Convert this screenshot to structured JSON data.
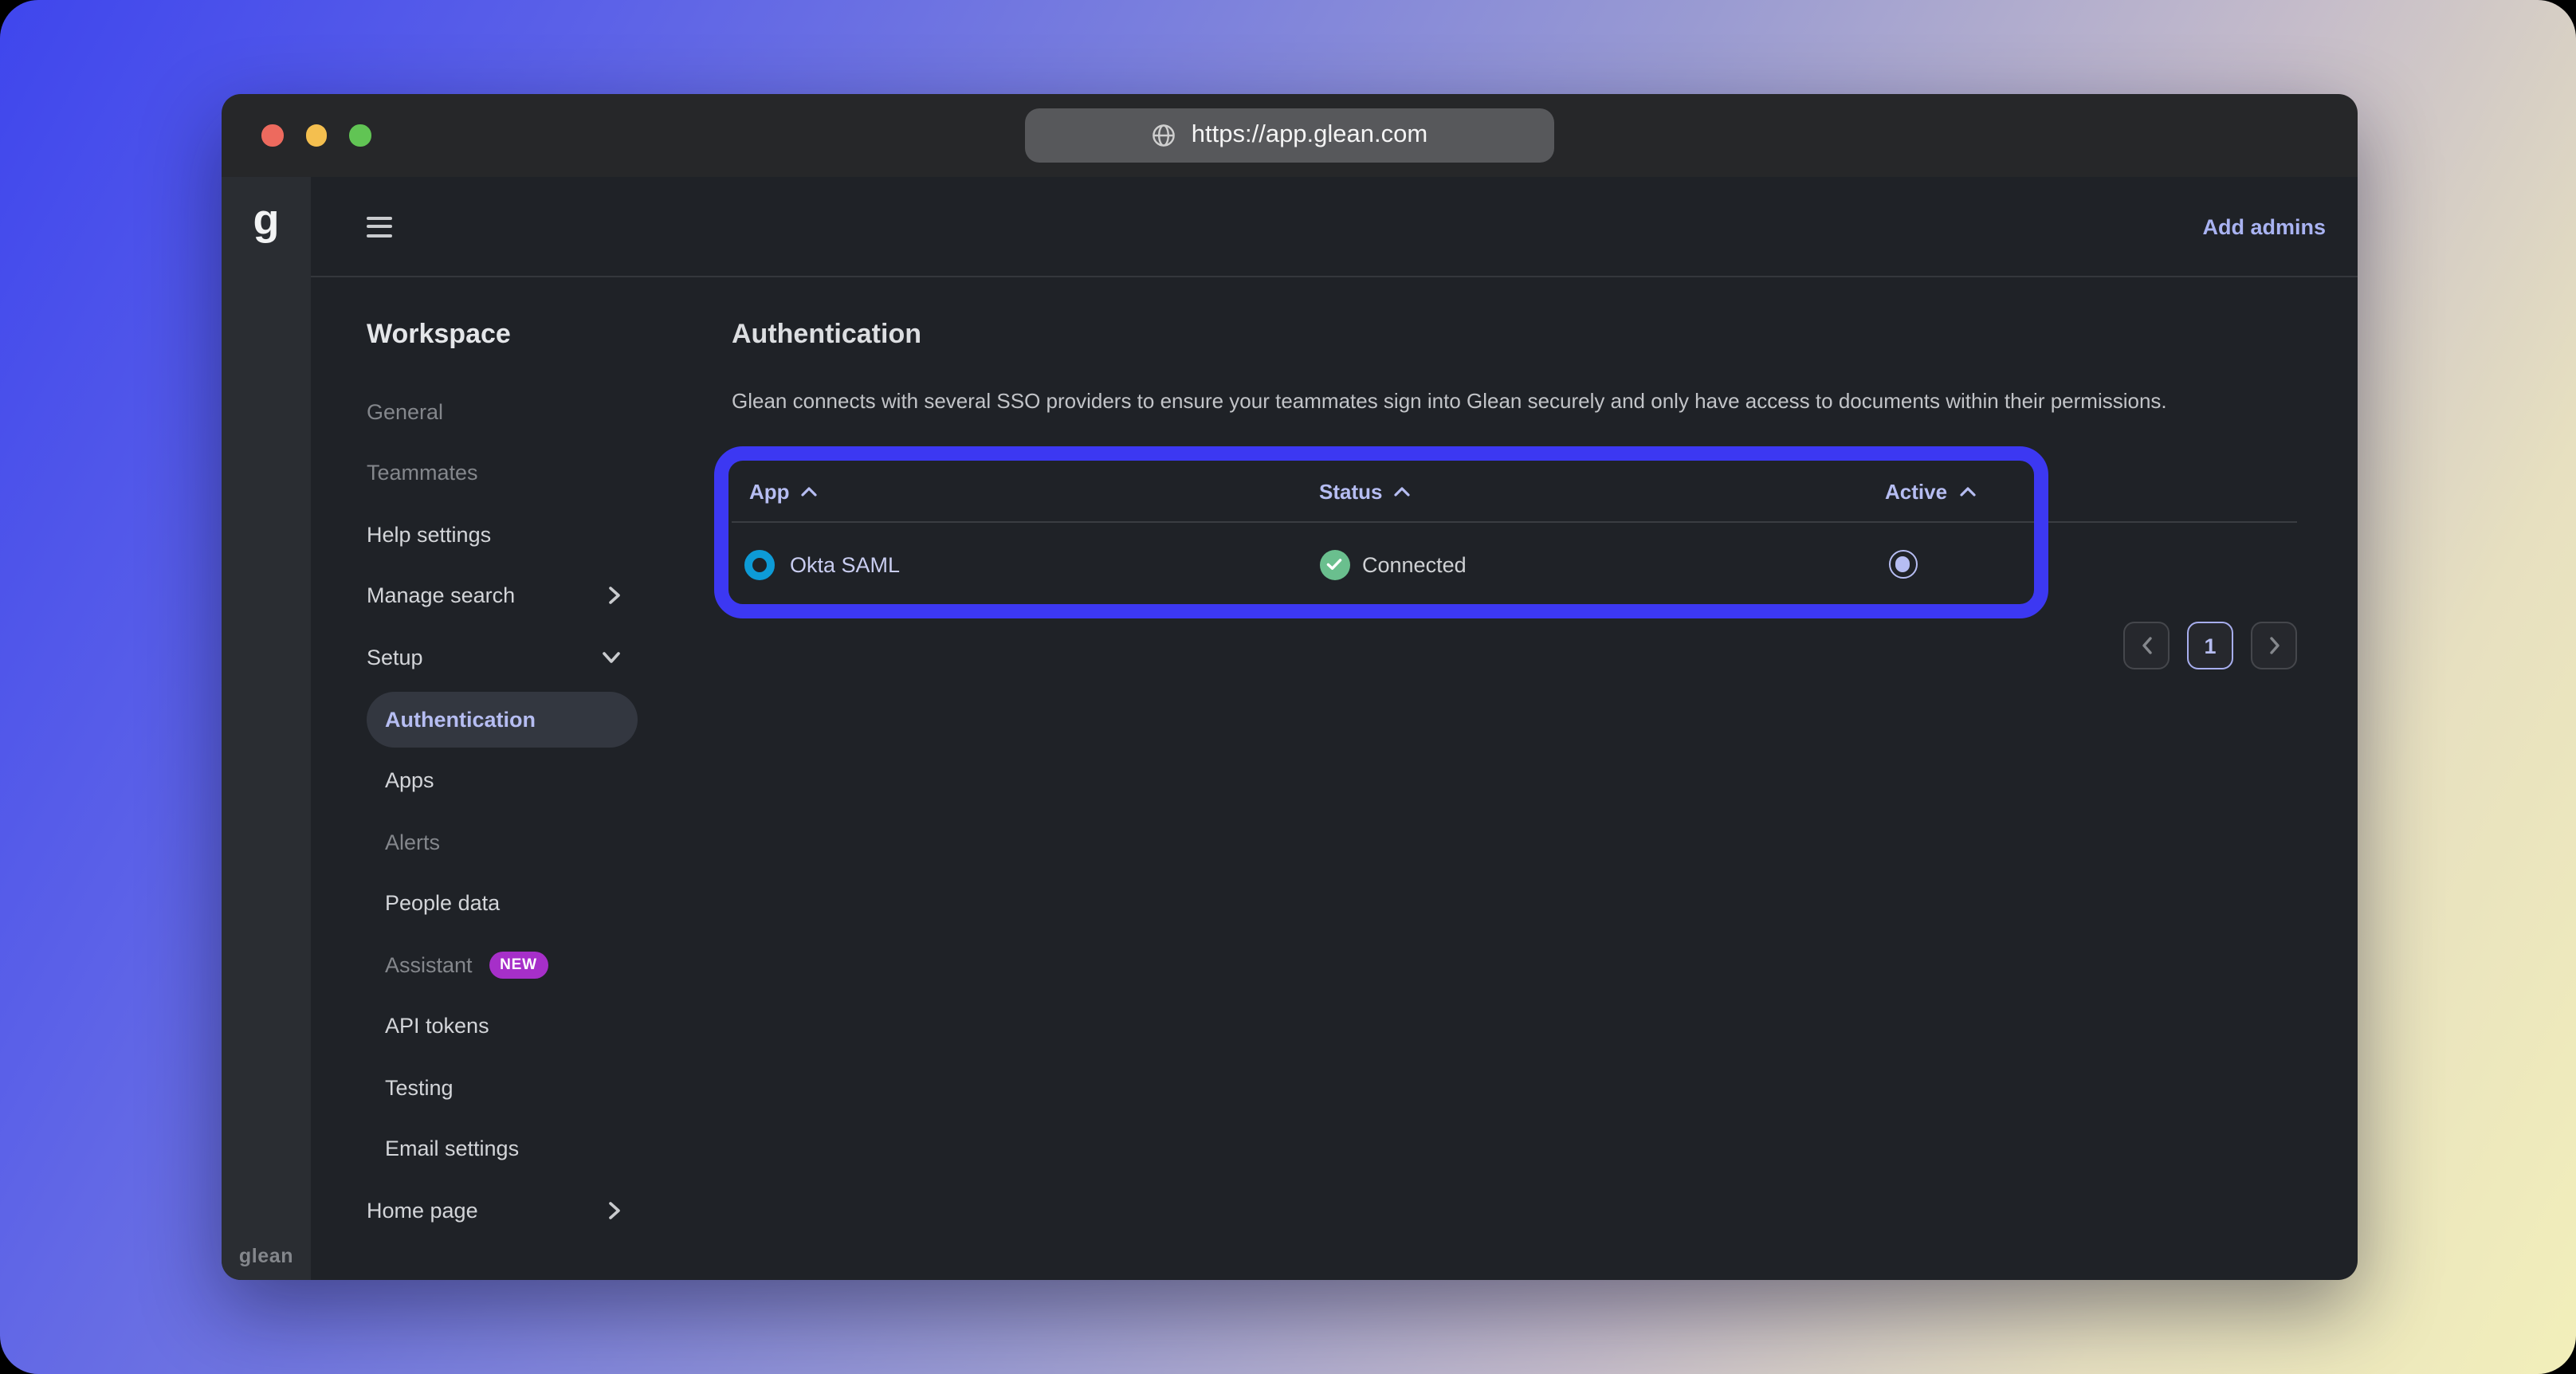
{
  "browser": {
    "url": "https://app.glean.com"
  },
  "brand": {
    "logo_letter": "g",
    "wordmark": "glean"
  },
  "app_header": {
    "add_admins_label": "Add admins"
  },
  "sidebar": {
    "items": [
      {
        "label": "Workspace",
        "kind": "section-header"
      },
      {
        "label": "General",
        "muted": true
      },
      {
        "label": "Teammates",
        "muted": true
      },
      {
        "label": "Help settings"
      },
      {
        "label": "Manage search",
        "chevron": "right"
      },
      {
        "label": "Setup",
        "chevron": "down",
        "expanded": true
      },
      {
        "label": "Authentication",
        "selected": true,
        "sub": true
      },
      {
        "label": "Apps",
        "sub": true
      },
      {
        "label": "Alerts",
        "muted": true,
        "sub": true
      },
      {
        "label": "People data",
        "sub": true
      },
      {
        "label": "Assistant",
        "muted": true,
        "sub": true,
        "badge": "NEW"
      },
      {
        "label": "API tokens",
        "sub": true
      },
      {
        "label": "Testing",
        "sub": true
      },
      {
        "label": "Email settings",
        "sub": true
      },
      {
        "label": "Home page",
        "chevron": "right"
      }
    ]
  },
  "main": {
    "title": "Authentication",
    "description": "Glean connects with several SSO providers to ensure your teammates sign into Glean securely and only have access to documents within their permissions.",
    "table": {
      "columns": {
        "app": "App",
        "status": "Status",
        "active": "Active"
      },
      "sorted_ascending": true,
      "rows": [
        {
          "app": "Okta SAML",
          "status": "Connected",
          "active": true
        }
      ]
    },
    "pagination": {
      "current_page": "1"
    }
  },
  "colors": {
    "highlight_annotation": "#3c38f2",
    "accent_lavender": "#b6bdf2",
    "okta_blue": "#0d9bd7",
    "status_green": "#6abf8e",
    "new_badge_purple": "#a62fc9",
    "background_gradient_start": "#3f46ed",
    "background_gradient_end": "#f2efba",
    "app_background": "#1f2227",
    "rail_background": "#2a2d32",
    "titlebar_background": "#262729"
  }
}
